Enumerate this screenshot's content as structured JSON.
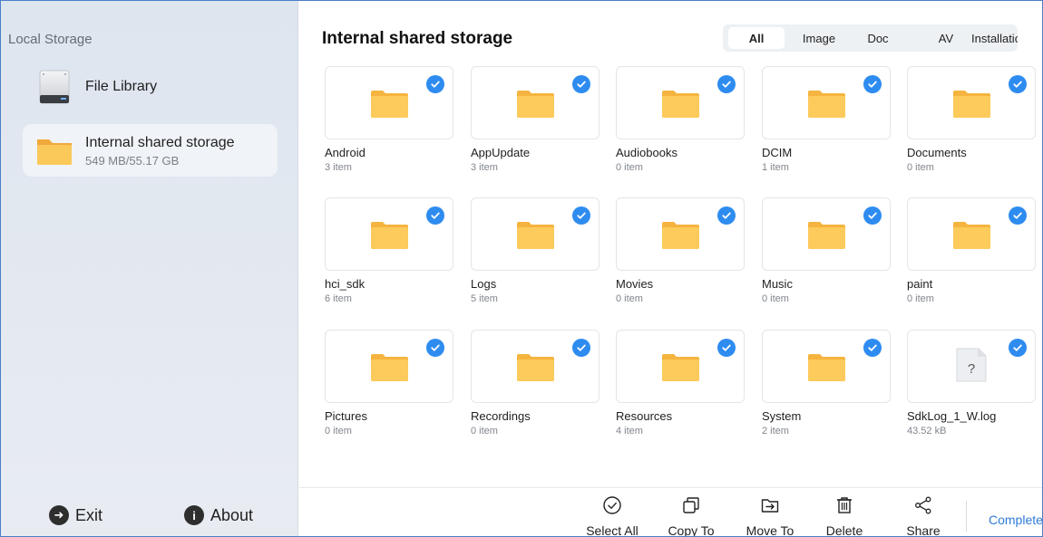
{
  "sidebar": {
    "title": "Local Storage",
    "items": [
      {
        "label": "File Library",
        "icon": "hard-drive-icon"
      },
      {
        "label": "Internal shared storage",
        "sub": "549 MB/55.17 GB",
        "icon": "folder-icon"
      }
    ],
    "exit_label": "Exit",
    "about_label": "About"
  },
  "main": {
    "title": "Internal shared storage",
    "filters": [
      "All",
      "Image",
      "Doc",
      "AV",
      "Installation"
    ],
    "active_filter": "All",
    "items": [
      {
        "name": "Android",
        "sub": "3 item",
        "type": "folder",
        "checked": true
      },
      {
        "name": "AppUpdate",
        "sub": "3 item",
        "type": "folder",
        "checked": true
      },
      {
        "name": "Audiobooks",
        "sub": "0 item",
        "type": "folder",
        "checked": true
      },
      {
        "name": "DCIM",
        "sub": "1 item",
        "type": "folder",
        "checked": true
      },
      {
        "name": "Documents",
        "sub": "0 item",
        "type": "folder",
        "checked": true
      },
      {
        "name": "hci_sdk",
        "sub": "6 item",
        "type": "folder",
        "checked": true
      },
      {
        "name": "Logs",
        "sub": "5 item",
        "type": "folder",
        "checked": true
      },
      {
        "name": "Movies",
        "sub": "0 item",
        "type": "folder",
        "checked": true
      },
      {
        "name": "Music",
        "sub": "0 item",
        "type": "folder",
        "checked": true
      },
      {
        "name": "paint",
        "sub": "0 item",
        "type": "folder",
        "checked": true
      },
      {
        "name": "Pictures",
        "sub": "0 item",
        "type": "folder",
        "checked": true
      },
      {
        "name": "Recordings",
        "sub": "0 item",
        "type": "folder",
        "checked": true
      },
      {
        "name": "Resources",
        "sub": "4 item",
        "type": "folder",
        "checked": true
      },
      {
        "name": "System",
        "sub": "2 item",
        "type": "folder",
        "checked": true
      },
      {
        "name": "SdkLog_1_W.log",
        "sub": "43.52 kB",
        "type": "file",
        "checked": true
      }
    ]
  },
  "toolbar": {
    "select_all": "Select All",
    "copy_to": "Copy To",
    "move_to": "Move To",
    "delete": "Delete",
    "share": "Share",
    "complete": "Complete"
  },
  "colors": {
    "accent": "#2e8cf0",
    "folder": "#f9c24b",
    "sidebar_bg": "#dde5ef",
    "complete_text": "#2e7bd6"
  }
}
